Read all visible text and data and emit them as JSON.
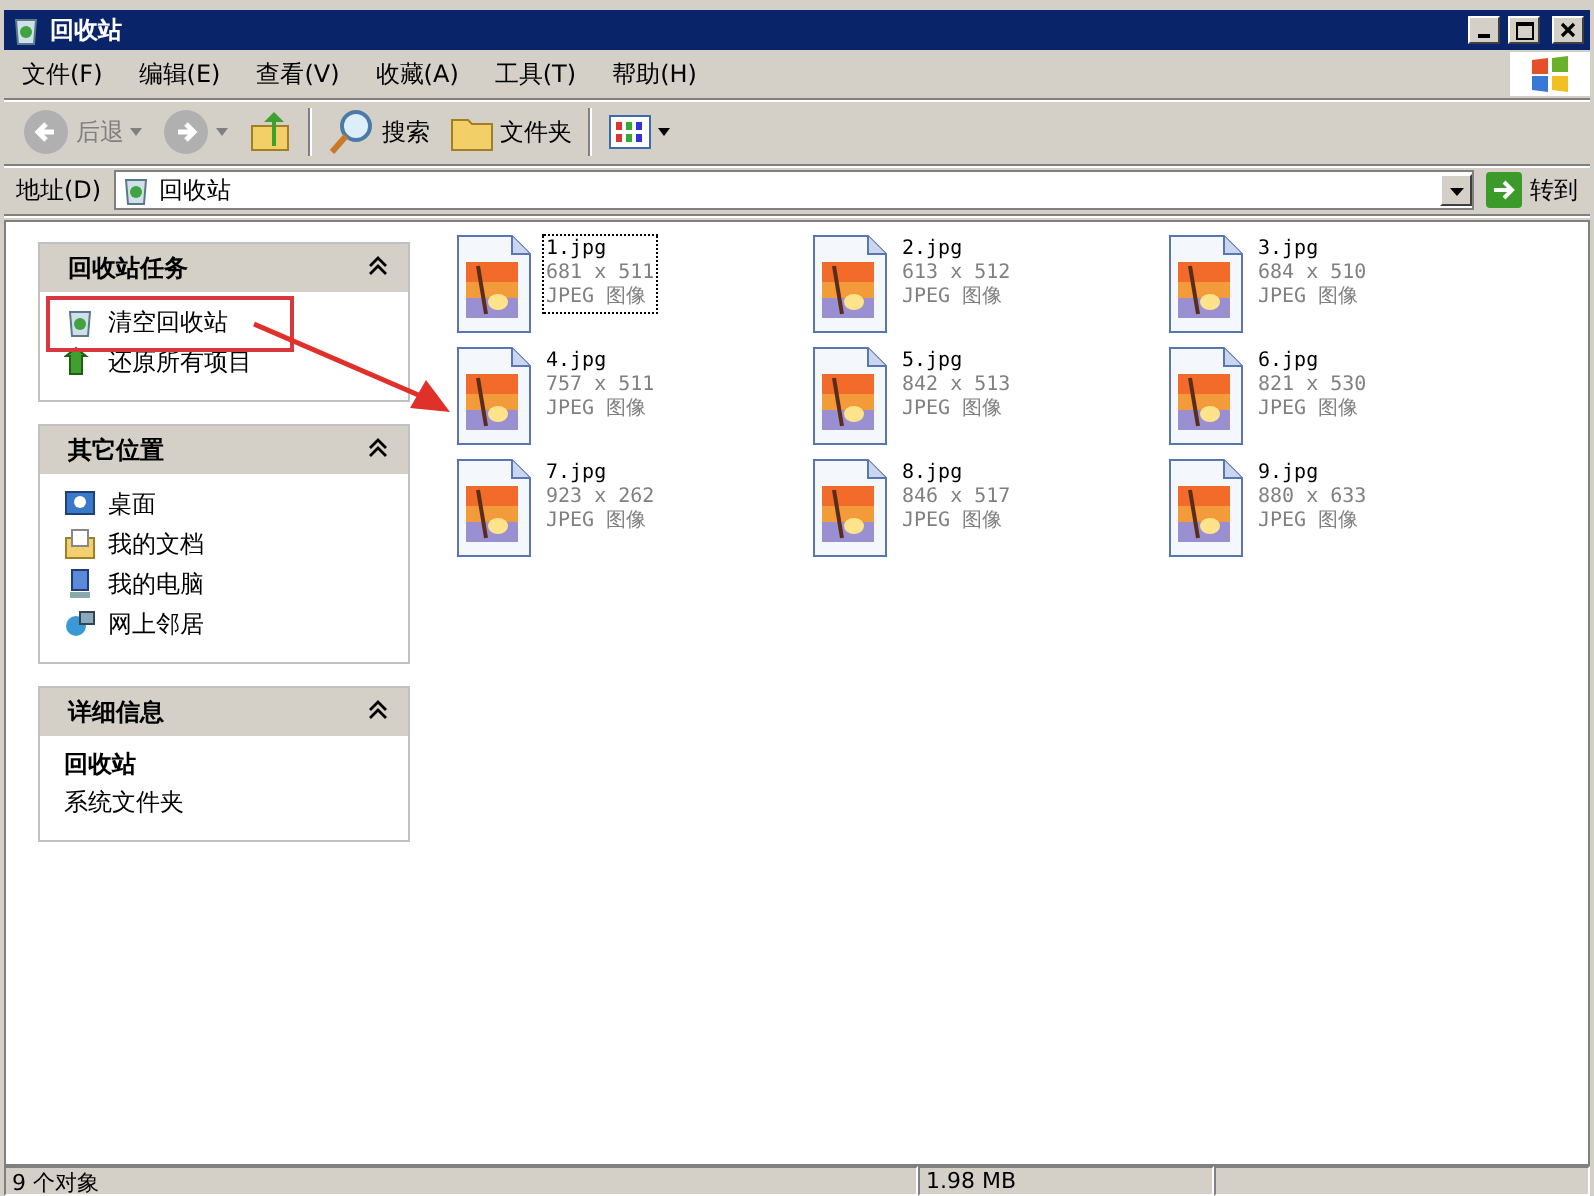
{
  "window": {
    "title": "回收站"
  },
  "menu": [
    "文件(F)",
    "编辑(E)",
    "查看(V)",
    "收藏(A)",
    "工具(T)",
    "帮助(H)"
  ],
  "toolbar": [
    {
      "kind": "back",
      "label": "后退",
      "disabled": true
    },
    {
      "kind": "forward",
      "disabled": true
    },
    {
      "kind": "up",
      "disabled": false
    },
    {
      "kind": "search",
      "label": "搜索",
      "disabled": false
    },
    {
      "kind": "folders",
      "label": "文件夹",
      "disabled": false
    },
    {
      "kind": "views",
      "disabled": false
    }
  ],
  "address": {
    "label": "地址(D)",
    "value": "回收站",
    "go": "转到"
  },
  "panels": [
    {
      "title": "回收站任务",
      "expanded": true,
      "items": [
        {
          "kind": "empty-bin",
          "label": "清空回收站"
        },
        {
          "kind": "restore",
          "label": "还原所有项目"
        }
      ]
    },
    {
      "title": "其它位置",
      "expanded": true,
      "items": [
        {
          "kind": "desktop",
          "label": "桌面"
        },
        {
          "kind": "documents",
          "label": "我的文档"
        },
        {
          "kind": "computer",
          "label": "我的电脑"
        },
        {
          "kind": "network",
          "label": "网上邻居"
        }
      ]
    },
    {
      "title": "详细信息",
      "expanded": true,
      "name": "回收站",
      "desc": "系统文件夹"
    }
  ],
  "files": [
    {
      "name": "1.jpg",
      "size": "681 x 511",
      "type": "JPEG 图像",
      "selected": true
    },
    {
      "name": "2.jpg",
      "size": "613 x 512",
      "type": "JPEG 图像",
      "selected": false
    },
    {
      "name": "3.jpg",
      "size": "684 x 510",
      "type": "JPEG 图像",
      "selected": false
    },
    {
      "name": "4.jpg",
      "size": "757 x 511",
      "type": "JPEG 图像",
      "selected": false
    },
    {
      "name": "5.jpg",
      "size": "842 x 513",
      "type": "JPEG 图像",
      "selected": false
    },
    {
      "name": "6.jpg",
      "size": "821 x 530",
      "type": "JPEG 图像",
      "selected": false
    },
    {
      "name": "7.jpg",
      "size": "923 x 262",
      "type": "JPEG 图像",
      "selected": false
    },
    {
      "name": "8.jpg",
      "size": "846 x 517",
      "type": "JPEG 图像",
      "selected": false
    },
    {
      "name": "9.jpg",
      "size": "880 x 633",
      "type": "JPEG 图像",
      "selected": false
    }
  ],
  "status_bar": {
    "count": "9 个对象",
    "size": "1.98 MB"
  }
}
